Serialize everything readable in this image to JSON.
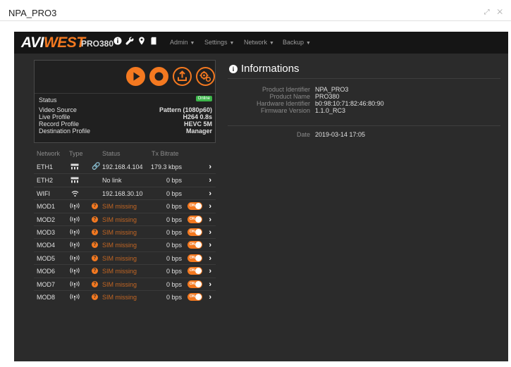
{
  "window": {
    "title": "NPA_PRO3",
    "controls": "⤢ ✕"
  },
  "nav": {
    "logo_a": "AVI",
    "logo_b": "WEST",
    "model": "PRO380",
    "icons": [
      "info-icon",
      "wrench-icon",
      "location-pin-icon",
      "sd-card-icon"
    ],
    "menus": [
      {
        "label": "Admin"
      },
      {
        "label": "Settings"
      },
      {
        "label": "Network"
      },
      {
        "label": "Backup"
      }
    ]
  },
  "controls": {
    "buttons": [
      "play-icon",
      "record-icon",
      "upload-icon",
      "gears-icon"
    ]
  },
  "status": {
    "label": "Status",
    "badge": "Online",
    "rows": [
      {
        "key": "Video Source",
        "value": "Pattern (1080p60)"
      },
      {
        "key": "Live Profile",
        "value": "H264 0.8s"
      },
      {
        "key": "Record Profile",
        "value": "HEVC 5M"
      },
      {
        "key": "Destination Profile",
        "value": "Manager"
      }
    ]
  },
  "network": {
    "headers": {
      "network": "Network",
      "type": "Type",
      "status": "Status",
      "bitrate": "Tx Bitrate"
    },
    "rows": [
      {
        "name": "ETH1",
        "type": "ethernet-icon",
        "status": "192.168.4.104",
        "bitrate": "179.3 kbps",
        "linked": true,
        "warn": false,
        "toggle": false
      },
      {
        "name": "ETH2",
        "type": "ethernet-icon",
        "status": "No link",
        "bitrate": "0 bps",
        "linked": false,
        "warn": false,
        "toggle": false
      },
      {
        "name": "WIFI",
        "type": "wifi-icon",
        "status": "192.168.30.10",
        "bitrate": "0 bps",
        "linked": false,
        "warn": false,
        "toggle": false
      },
      {
        "name": "MOD1",
        "type": "antenna-icon",
        "status": "SIM missing",
        "bitrate": "0 bps",
        "linked": false,
        "warn": true,
        "toggle": true
      },
      {
        "name": "MOD2",
        "type": "antenna-icon",
        "status": "SIM missing",
        "bitrate": "0 bps",
        "linked": false,
        "warn": true,
        "toggle": true
      },
      {
        "name": "MOD3",
        "type": "antenna-icon",
        "status": "SIM missing",
        "bitrate": "0 bps",
        "linked": false,
        "warn": true,
        "toggle": true
      },
      {
        "name": "MOD4",
        "type": "antenna-icon",
        "status": "SIM missing",
        "bitrate": "0 bps",
        "linked": false,
        "warn": true,
        "toggle": true
      },
      {
        "name": "MOD5",
        "type": "antenna-icon",
        "status": "SIM missing",
        "bitrate": "0 bps",
        "linked": false,
        "warn": true,
        "toggle": true
      },
      {
        "name": "MOD6",
        "type": "antenna-icon",
        "status": "SIM missing",
        "bitrate": "0 bps",
        "linked": false,
        "warn": true,
        "toggle": true
      },
      {
        "name": "MOD7",
        "type": "antenna-icon",
        "status": "SIM missing",
        "bitrate": "0 bps",
        "linked": false,
        "warn": true,
        "toggle": true
      },
      {
        "name": "MOD8",
        "type": "antenna-icon",
        "status": "SIM missing",
        "bitrate": "0 bps",
        "linked": false,
        "warn": true,
        "toggle": true
      }
    ],
    "toggle_label": "ON"
  },
  "info": {
    "title": "Informations",
    "rows": [
      {
        "key": "Product Identifier",
        "value": "NPA_PRO3"
      },
      {
        "key": "Product Name",
        "value": "PRO380"
      },
      {
        "key": "Hardware Identifier",
        "value": "b0:98:10:71:82:46:80:90"
      },
      {
        "key": "Firmware Version",
        "value": "1.1.0_RC3"
      }
    ],
    "date_label": "Date",
    "date_value": "2019-03-14 17:05"
  },
  "colors": {
    "accent": "#f47920",
    "background": "#2b2b2b",
    "navbar": "#151515",
    "online": "#3cb54a"
  }
}
